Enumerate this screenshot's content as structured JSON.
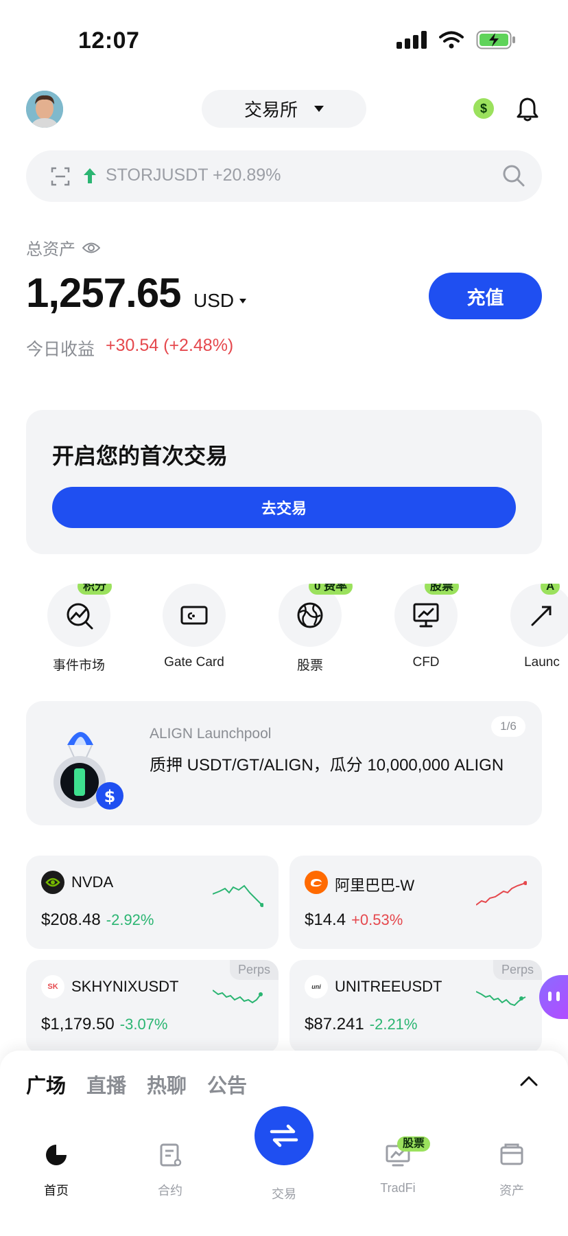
{
  "status_bar": {
    "time": "12:07"
  },
  "header": {
    "exchange_label": "交易所",
    "coin_badge": "$"
  },
  "search": {
    "text": "STORJUSDT +20.89%"
  },
  "assets": {
    "label": "总资产",
    "value": "1,257.65",
    "currency": "USD",
    "deposit_label": "充值",
    "pnl_label": "今日收益",
    "pnl_value": "+30.54 (+2.48%)"
  },
  "first_trade": {
    "title": "开启您的首次交易",
    "button_label": "去交易"
  },
  "quick_links": [
    {
      "label": "事件市场",
      "tag": "积分",
      "icon": "trend-icon"
    },
    {
      "label": "Gate Card",
      "tag": "",
      "icon": "card-icon"
    },
    {
      "label": "股票",
      "tag": "0 费率",
      "icon": "globe-icon"
    },
    {
      "label": "CFD",
      "tag": "股票",
      "icon": "monitor-chart-icon"
    },
    {
      "label": "Launc",
      "tag": "A",
      "icon": "launch-icon"
    }
  ],
  "launchpool": {
    "title": "ALIGN Launchpool",
    "description": "质押 USDT/GT/ALIGN，瓜分 10,000,000 ALIGN",
    "page": "1/6"
  },
  "markets": [
    {
      "symbol": "NVDA",
      "price": "$208.48",
      "change": "-2.92%",
      "perps": "",
      "trend": "down"
    },
    {
      "symbol": "阿里巴巴-W",
      "price": "$14.4",
      "change": "+0.53%",
      "perps": "",
      "trend": "up"
    },
    {
      "symbol": "SKHYNIXUSDT",
      "price": "$1,179.50",
      "change": "-3.07%",
      "perps": "Perps",
      "trend": "down"
    },
    {
      "symbol": "UNITREEUSDT",
      "price": "$87.241",
      "change": "-2.21%",
      "perps": "Perps",
      "trend": "down"
    }
  ],
  "sheet": {
    "tabs": [
      "广场",
      "直播",
      "热聊",
      "公告"
    ]
  },
  "tabbar": [
    {
      "label": "首页"
    },
    {
      "label": "合约"
    },
    {
      "label": "交易"
    },
    {
      "label": "TradFi",
      "tag": "股票"
    },
    {
      "label": "资产"
    }
  ],
  "colors": {
    "accent": "#1f4ff1",
    "positive": "#e5484d",
    "negative": "#2bb572",
    "tag": "#9be15d"
  }
}
